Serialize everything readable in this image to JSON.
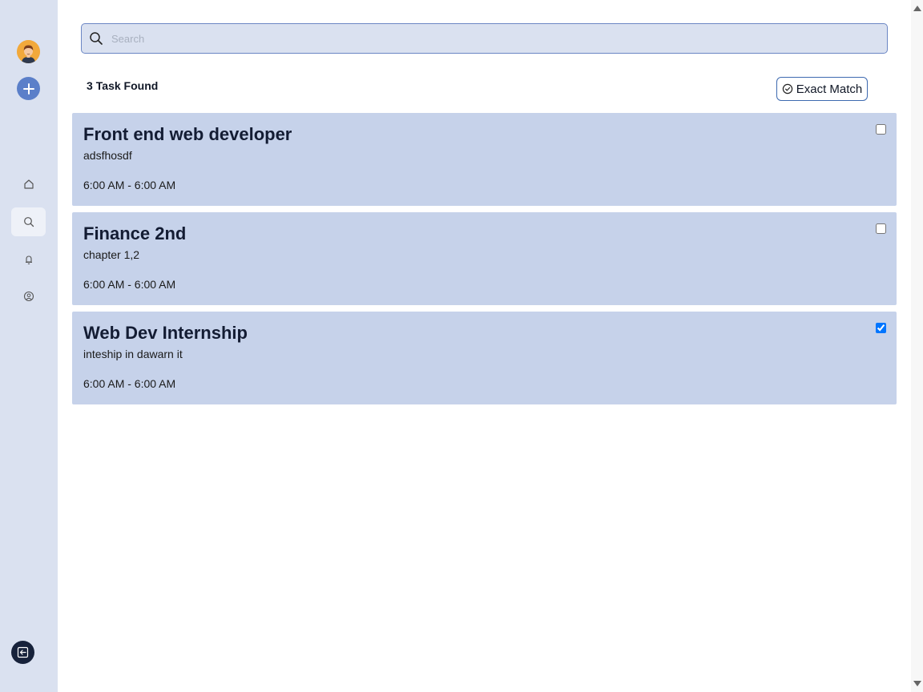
{
  "sidebar": {
    "icons": {
      "avatar": "avatar-icon",
      "add": "plus-icon",
      "home": "home-icon",
      "search": "search-icon",
      "notifications": "bell-icon",
      "profile": "user-circle-icon",
      "logout": "logout-icon"
    },
    "active_item": "search"
  },
  "search": {
    "placeholder": "Search",
    "value": ""
  },
  "results": {
    "count": "3",
    "label": "Task Found"
  },
  "exact_match": {
    "label": "Exact Match"
  },
  "tasks": [
    {
      "title": "Front end web developer",
      "description": "adsfhosdf",
      "time": "6:00 AM - 6:00 AM",
      "checked": false
    },
    {
      "title": "Finance 2nd",
      "description": "chapter 1,2",
      "time": "6:00 AM - 6:00 AM",
      "checked": false
    },
    {
      "title": "Web Dev Internship",
      "description": "inteship in dawarn it",
      "time": "6:00 AM - 6:00 AM",
      "checked": true
    }
  ],
  "colors": {
    "sidebar_bg": "#dae1f0",
    "card_bg": "#c6d2ea",
    "accent": "#5b7fc9",
    "dark": "#17223b"
  }
}
